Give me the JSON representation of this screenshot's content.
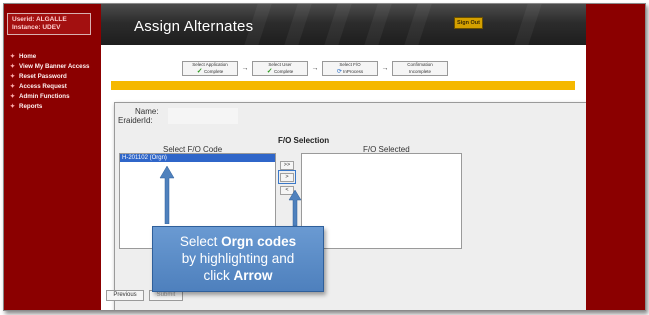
{
  "user": {
    "line1": "Userid: ALGALLE",
    "line2": "Instance: UDEV"
  },
  "nav": {
    "items": [
      {
        "label": "Home"
      },
      {
        "label": "View My Banner Access"
      },
      {
        "label": "Reset Password"
      },
      {
        "label": "Access Request"
      },
      {
        "label": "Admin Functions"
      },
      {
        "label": "Reports"
      }
    ]
  },
  "header": {
    "title": "Assign Alternates",
    "signout_label": "Sign Out"
  },
  "steps": [
    {
      "title": "Select Application",
      "status": "Complete",
      "icon": "check-icon"
    },
    {
      "title": "Select User",
      "status": "Complete",
      "icon": "check-icon"
    },
    {
      "title": "Select F/O",
      "status": "InProcess",
      "icon": "refresh-icon"
    },
    {
      "title": "Confirmation",
      "status": "Incomplete",
      "icon": ""
    }
  ],
  "form": {
    "name_label": "Name:",
    "eraider_label": "EraiderId:",
    "fo_heading": "F/O Selection",
    "left_header": "Select F/O Code",
    "right_header": "F/O Selected",
    "left_items": [
      "H-201102 (Orgn)"
    ],
    "move_all_right": ">>",
    "move_right": ">",
    "move_left": "<"
  },
  "footer": {
    "previous_label": "Previous",
    "submit_label": "Submit"
  },
  "callout": {
    "part1": "Select ",
    "bold1": "Orgn codes",
    "line2": "by highlighting and",
    "part3": "click ",
    "bold3": "Arrow"
  },
  "colors": {
    "brand": "#8b0000",
    "accent": "#f5b800",
    "selection": "#2f66c9",
    "callout": "#4f81bd"
  }
}
